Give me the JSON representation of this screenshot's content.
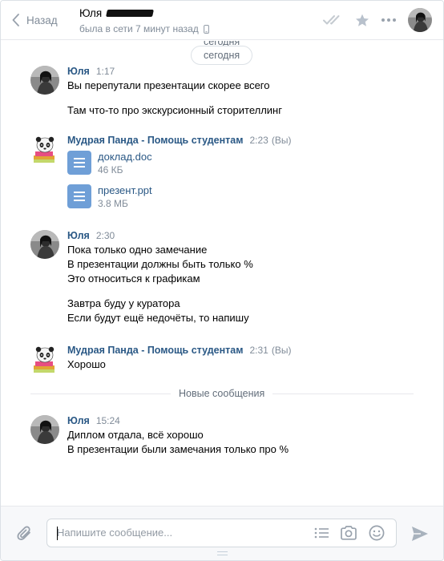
{
  "header": {
    "back_label": "Назад",
    "peer_name": "Юля",
    "peer_status": "была в сети 7 минут назад"
  },
  "history": {
    "ghost_date": "сегодня",
    "date_label": "сегодня",
    "new_messages_label": "Новые сообщения",
    "groups": [
      {
        "author": "Юля",
        "time": "1:17",
        "lines": [
          "Вы перепутали презентации скорее всего",
          "",
          "Там что-то про экскурсионный сторителлинг"
        ]
      },
      {
        "author": "Мудрая Панда - Помощь студентам",
        "time": "2:23",
        "you_label": "(Вы)",
        "files": [
          {
            "name": "доклад.doc",
            "size": "46 КБ"
          },
          {
            "name": "презент.ppt",
            "size": "3.8 МБ"
          }
        ]
      },
      {
        "author": "Юля",
        "time": "2:30",
        "lines": [
          "Пока только одно замечание",
          "В презентации должны быть только %",
          "Это относиться к графикам",
          "",
          "Завтра буду у куратора",
          "Если будут ещё недочёты, то напишу"
        ]
      },
      {
        "author": "Мудрая Панда - Помощь студентам",
        "time": "2:31",
        "you_label": "(Вы)",
        "lines": [
          "Хорошо"
        ]
      },
      {
        "author": "Юля",
        "time": "15:24",
        "lines": [
          "Диплом отдала, всё хорошо",
          "В презентации были замечания только про %"
        ]
      }
    ]
  },
  "composer": {
    "placeholder": "Напишите сообщение..."
  },
  "colors": {
    "link": "#2a5885",
    "muted": "#818c99",
    "file_icon": "#6f9fd7",
    "icon": "#99a2ad"
  }
}
